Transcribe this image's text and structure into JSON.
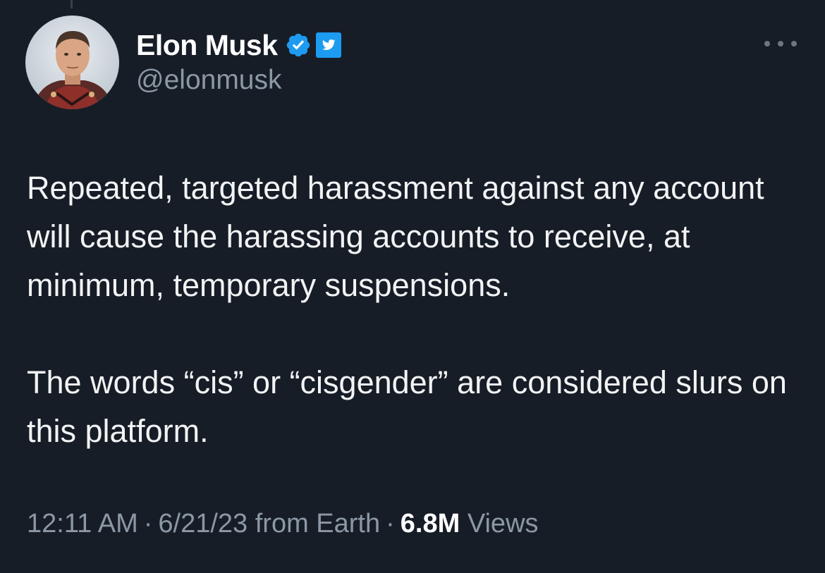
{
  "tweet": {
    "author": {
      "display_name": "Elon Musk",
      "handle": "@elonmusk",
      "verified_icon": "verified-badge-icon",
      "affiliate_icon": "twitter-bird-icon"
    },
    "paragraphs": [
      "Repeated, targeted harassment against any account will cause the harassing accounts to receive, at minimum, temporary suspensions.",
      "The words “cis” or “cisgender” are considered slurs on this platform."
    ],
    "time": "12:11 AM",
    "separator": "·",
    "date_source": "6/21/23 from Earth",
    "views_count": "6.8M",
    "views_label": "Views",
    "more_icon": "more-options-icon"
  },
  "colors": {
    "background": "#171d27",
    "text": "#e7e9ea",
    "secondary_text": "#8b98a5",
    "verified_blue": "#1d9bf0"
  }
}
